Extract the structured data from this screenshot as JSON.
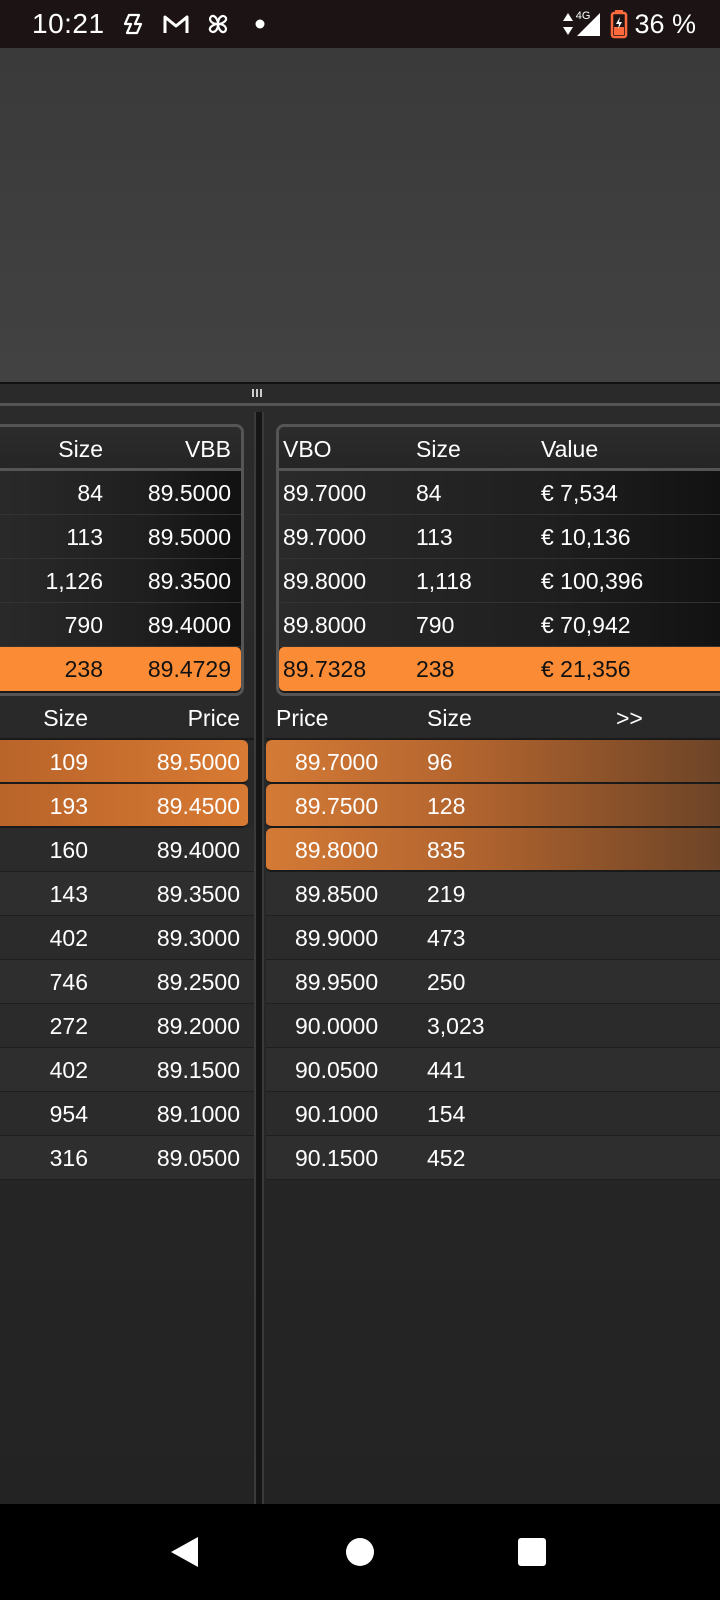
{
  "status_bar": {
    "time": "10:21",
    "network": "4G",
    "battery": "36 %",
    "icons": [
      "copilot-icon",
      "gmail-icon",
      "pinwheel-icon",
      "dot-icon",
      "data-arrows-icon",
      "signal-icon",
      "battery-icon"
    ]
  },
  "summary_left": {
    "headers": [
      "Size",
      "VBB"
    ],
    "rows": [
      {
        "size": "84",
        "vbb": "89.5000"
      },
      {
        "size": "113",
        "vbb": "89.5000"
      },
      {
        "size": "1,126",
        "vbb": "89.3500"
      },
      {
        "size": "790",
        "vbb": "89.4000"
      },
      {
        "size": "238",
        "vbb": "89.4729"
      }
    ]
  },
  "summary_right": {
    "headers": [
      "VBO",
      "Size",
      "Value"
    ],
    "rows": [
      {
        "vbo": "89.7000",
        "size": "84",
        "value": "€ 7,534"
      },
      {
        "vbo": "89.7000",
        "size": "113",
        "value": "€ 10,136"
      },
      {
        "vbo": "89.8000",
        "size": "1,118",
        "value": "€ 100,396"
      },
      {
        "vbo": "89.8000",
        "size": "790",
        "value": "€ 70,942"
      },
      {
        "vbo": "89.7328",
        "size": "238",
        "value": "€ 21,356"
      }
    ]
  },
  "bid_book": {
    "headers": [
      "Size",
      "Price"
    ],
    "rows": [
      {
        "size": "109",
        "price": "89.5000"
      },
      {
        "size": "193",
        "price": "89.4500"
      },
      {
        "size": "160",
        "price": "89.4000"
      },
      {
        "size": "143",
        "price": "89.3500"
      },
      {
        "size": "402",
        "price": "89.3000"
      },
      {
        "size": "746",
        "price": "89.2500"
      },
      {
        "size": "272",
        "price": "89.2000"
      },
      {
        "size": "402",
        "price": "89.1500"
      },
      {
        "size": "954",
        "price": "89.1000"
      },
      {
        "size": "316",
        "price": "89.0500"
      }
    ]
  },
  "ask_book": {
    "headers": [
      "Price",
      "Size",
      ">>"
    ],
    "rows": [
      {
        "price": "89.7000",
        "size": "96"
      },
      {
        "price": "89.7500",
        "size": "128"
      },
      {
        "price": "89.8000",
        "size": "835"
      },
      {
        "price": "89.8500",
        "size": "219"
      },
      {
        "price": "89.9000",
        "size": "473"
      },
      {
        "price": "89.9500",
        "size": "250"
      },
      {
        "price": "90.0000",
        "size": "3,023"
      },
      {
        "price": "90.0500",
        "size": "441"
      },
      {
        "price": "90.1000",
        "size": "154"
      },
      {
        "price": "90.1500",
        "size": "452"
      }
    ]
  },
  "colors": {
    "accent": "#fb8b34",
    "highlight_row": "#c86f30"
  },
  "nav": [
    "back-icon",
    "home-icon",
    "recents-icon"
  ]
}
